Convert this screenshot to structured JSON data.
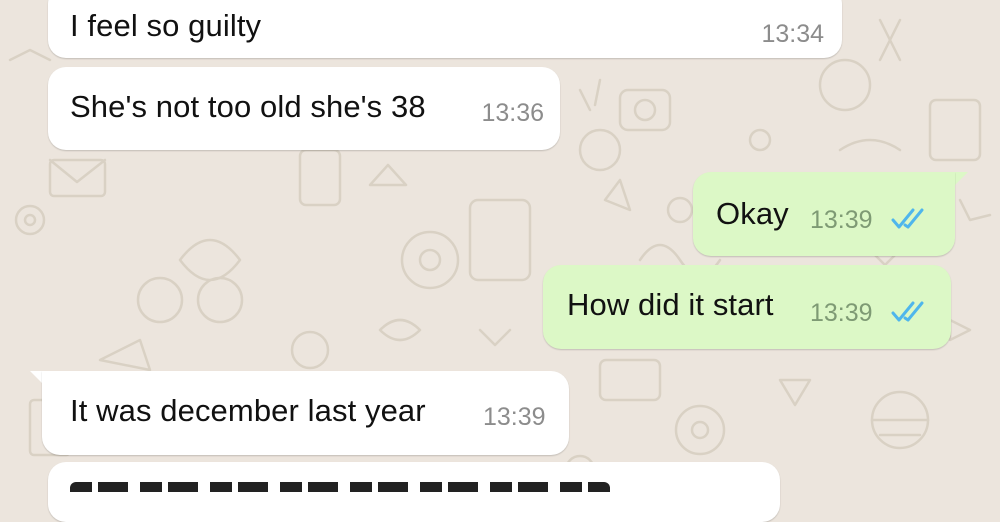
{
  "conversation": {
    "messages": [
      {
        "direction": "incoming",
        "text": "I feel so guilty",
        "time": "13:34"
      },
      {
        "direction": "incoming",
        "text": "She's not too old she's 38",
        "time": "13:36"
      },
      {
        "direction": "outgoing",
        "text": "Okay",
        "time": "13:39",
        "status": "read"
      },
      {
        "direction": "outgoing",
        "text": "How did it start",
        "time": "13:39",
        "status": "read"
      },
      {
        "direction": "incoming",
        "text": "It was december last year",
        "time": "13:39"
      },
      {
        "direction": "incoming",
        "text": "",
        "time": ""
      }
    ]
  },
  "colors": {
    "background": "#ECE5DD",
    "incoming_bubble": "#FFFFFF",
    "outgoing_bubble": "#DCF8C6",
    "read_ticks": "#4FB6EC"
  },
  "icons": {
    "read_receipt": "double-check-icon",
    "wallpaper": "doodle-pattern"
  }
}
